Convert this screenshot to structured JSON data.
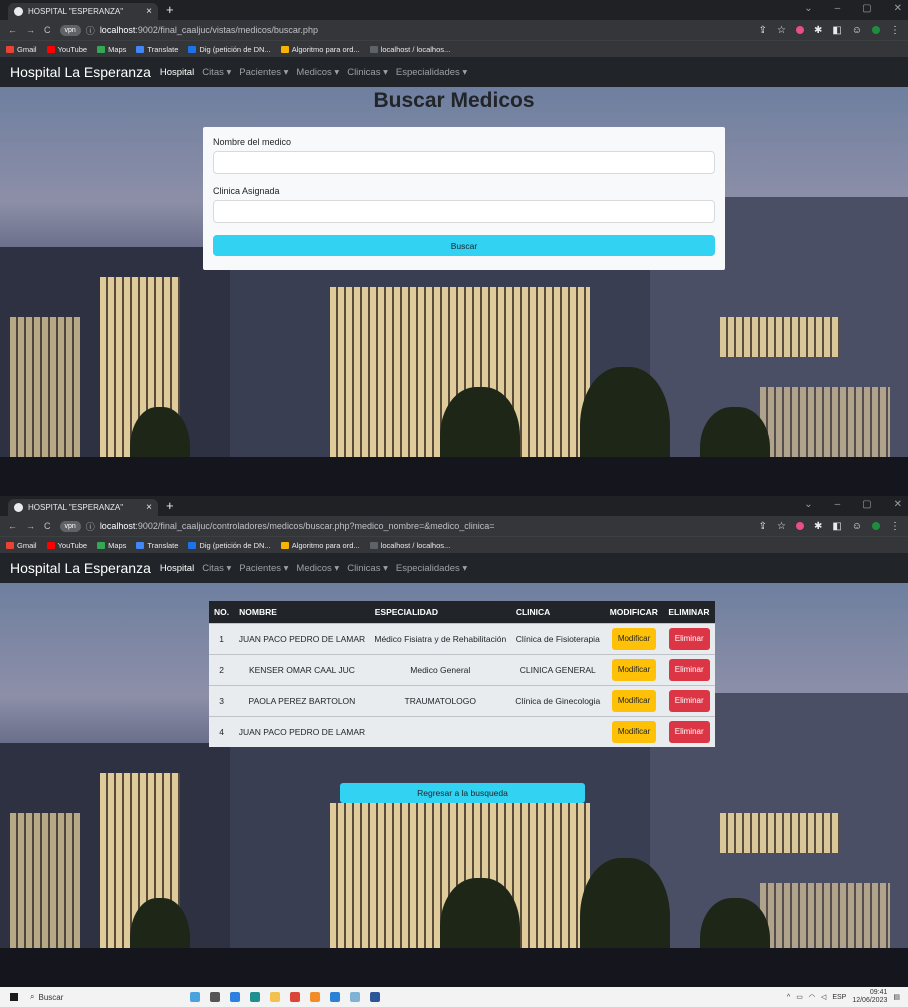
{
  "browser": {
    "tab_title": "HOSPITAL \"ESPERANZA\"",
    "tab_close": "×",
    "new_tab": "+",
    "url_prefix": "localhost",
    "url1": ":9002/final_caaljuc/vistas/medicos/buscar.php",
    "url2": ":9002/final_caaljuc/controladores/medicos/buscar.php?medico_nombre=&medico_clinica=",
    "bookmarks": [
      {
        "label": "Gmail",
        "color": "#ea4335"
      },
      {
        "label": "YouTube",
        "color": "#ff0000"
      },
      {
        "label": "Maps",
        "color": "#34a853"
      },
      {
        "label": "Translate",
        "color": "#4285f4"
      },
      {
        "label": "Dig (petición de DN...",
        "color": "#1a73e8"
      },
      {
        "label": "Algoritmo para ord...",
        "color": "#f4b400"
      },
      {
        "label": "localhost / localhos...",
        "color": "#5f6368"
      }
    ]
  },
  "navbar": {
    "brand": "Hospital La Esperanza",
    "links": [
      "Hospital",
      "Citas ▾",
      "Pacientes ▾",
      "Medicos ▾",
      "Clinicas ▾",
      "Especialidades ▾"
    ]
  },
  "search_page": {
    "title": "Buscar Medicos",
    "field1_label": "Nombre del medico",
    "field1_value": "",
    "field2_label": "Clinica Asignada",
    "field2_value": "",
    "submit_label": "Buscar"
  },
  "results_page": {
    "headers": [
      "NO.",
      "NOMBRE",
      "ESPECIALIDAD",
      "CLINICA",
      "MODIFICAR",
      "ELIMINAR"
    ],
    "rows": [
      {
        "no": "1",
        "nombre": "JUAN PACO PEDRO DE LAMAR",
        "especialidad": "Médico Fisiatra y de Rehabilitación",
        "clinica": "Clínica de Fisioterapia"
      },
      {
        "no": "2",
        "nombre": "KENSER OMAR CAAL JUC",
        "especialidad": "Medico General",
        "clinica": "CLINICA GENERAL"
      },
      {
        "no": "3",
        "nombre": "PAOLA PEREZ BARTOLON",
        "especialidad": "TRAUMATOLOGO",
        "clinica": "Clínica de Ginecologia"
      },
      {
        "no": "4",
        "nombre": "JUAN PACO PEDRO DE LAMAR",
        "especialidad": "",
        "clinica": ""
      }
    ],
    "modify_label": "Modificar",
    "delete_label": "Eliminar",
    "back_label": "Regresar a la busqueda"
  },
  "taskbar": {
    "search_label": "Buscar",
    "language": "ESP",
    "time": "09:41",
    "date": "12/06/2023"
  }
}
